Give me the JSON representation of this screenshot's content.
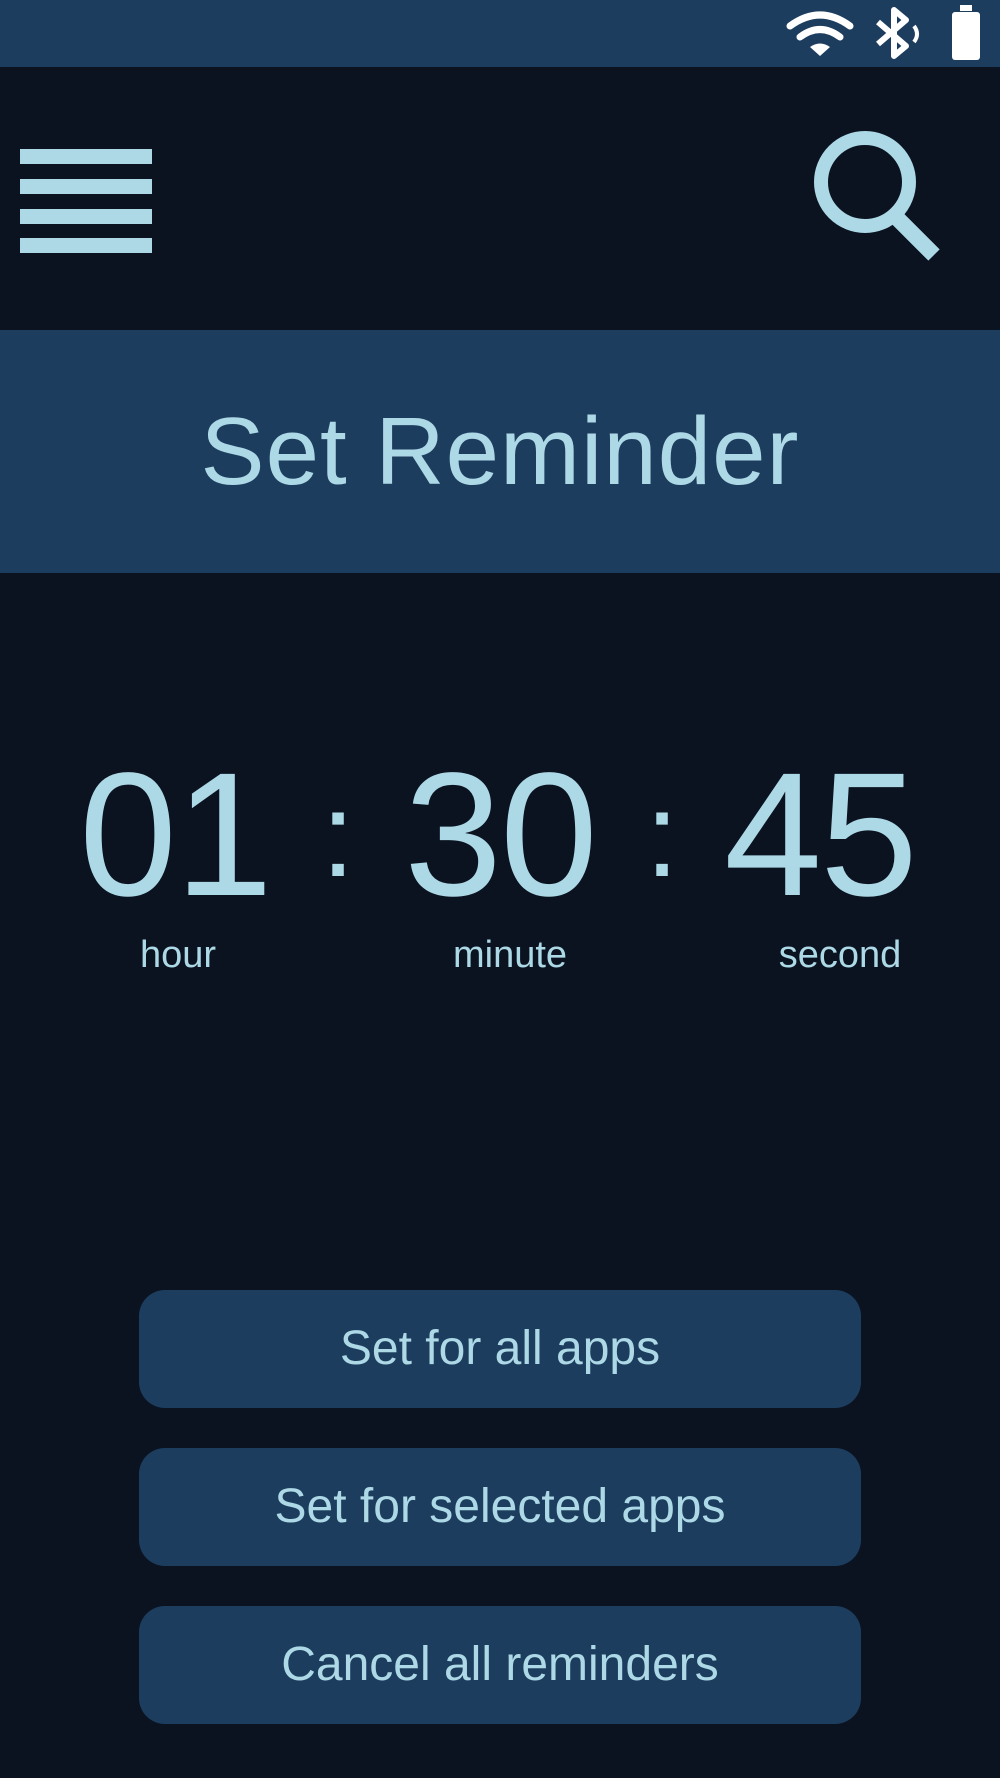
{
  "status_bar": {
    "icons": [
      "wifi-icon",
      "bluetooth-icon",
      "battery-icon"
    ]
  },
  "app_bar": {
    "menu_icon": "hamburger-menu-icon",
    "search_icon": "search-icon"
  },
  "header": {
    "title": "Set Reminder"
  },
  "timer": {
    "hour": "01",
    "minute": "30",
    "second": "45",
    "separator": ":",
    "hour_label": "hour",
    "minute_label": "minute",
    "second_label": "second"
  },
  "actions": {
    "set_all": "Set for all apps",
    "set_selected": "Set for selected apps",
    "cancel_all": "Cancel all reminders"
  },
  "colors": {
    "background": "#0b1320",
    "panel": "#1d3d5f",
    "accent": "#add8e6"
  }
}
